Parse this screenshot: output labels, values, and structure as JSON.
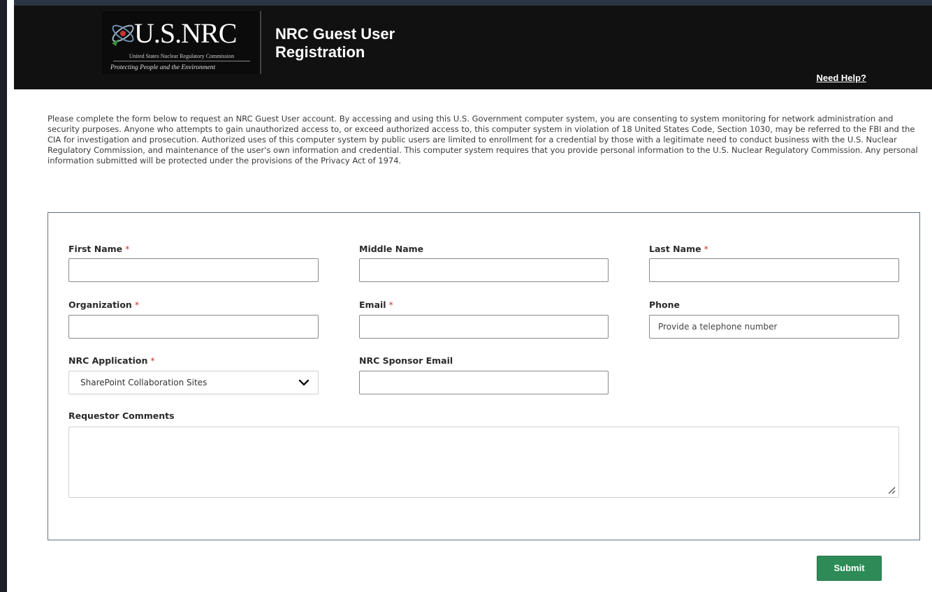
{
  "header": {
    "logo_text": "U.S.NRC",
    "logo_subtitle": "United States Nuclear Regulatory Commission",
    "logo_tagline": "Protecting People and the Environment",
    "title": "NRC Guest User Registration",
    "help_label": "Need Help?"
  },
  "intro_text": "Please complete the form below to request an NRC Guest User account. By accessing and using this U.S. Government computer system, you are consenting to system monitoring for network administration and security purposes. Anyone who attempts to gain unauthorized access to, or exceed authorized access to, this computer system in violation of 18 United States Code, Section 1030, may be referred to the FBI and the CIA for investigation and prosecution. Authorized uses of this computer system by public users are limited to enrollment for a credential by those with a legitimate need to conduct business with the U.S. Nuclear Regulatory Commission, and maintenance of the user's own information and credential. This computer system requires that you provide personal information to the U.S. Nuclear Regulatory Commission. Any personal information submitted will be protected under the provisions of the Privacy Act of 1974.",
  "form": {
    "required_marker": "*",
    "first_name": {
      "label": "First Name",
      "value": ""
    },
    "middle_name": {
      "label": "Middle Name",
      "value": ""
    },
    "last_name": {
      "label": "Last Name",
      "value": ""
    },
    "organization": {
      "label": "Organization",
      "value": ""
    },
    "email": {
      "label": "Email",
      "value": ""
    },
    "phone": {
      "label": "Phone",
      "placeholder": "Provide a telephone number"
    },
    "nrc_application": {
      "label": "NRC Application",
      "selected": "SharePoint Collaboration Sites"
    },
    "sponsor_email": {
      "label": "NRC Sponsor Email",
      "value": ""
    },
    "comments": {
      "label": "Requestor Comments"
    },
    "submit_label": "Submit"
  },
  "colors": {
    "header_bg": "#111111",
    "submit_bg": "#2e8b57",
    "required": "#c0392b",
    "form_border": "#5f7182"
  }
}
